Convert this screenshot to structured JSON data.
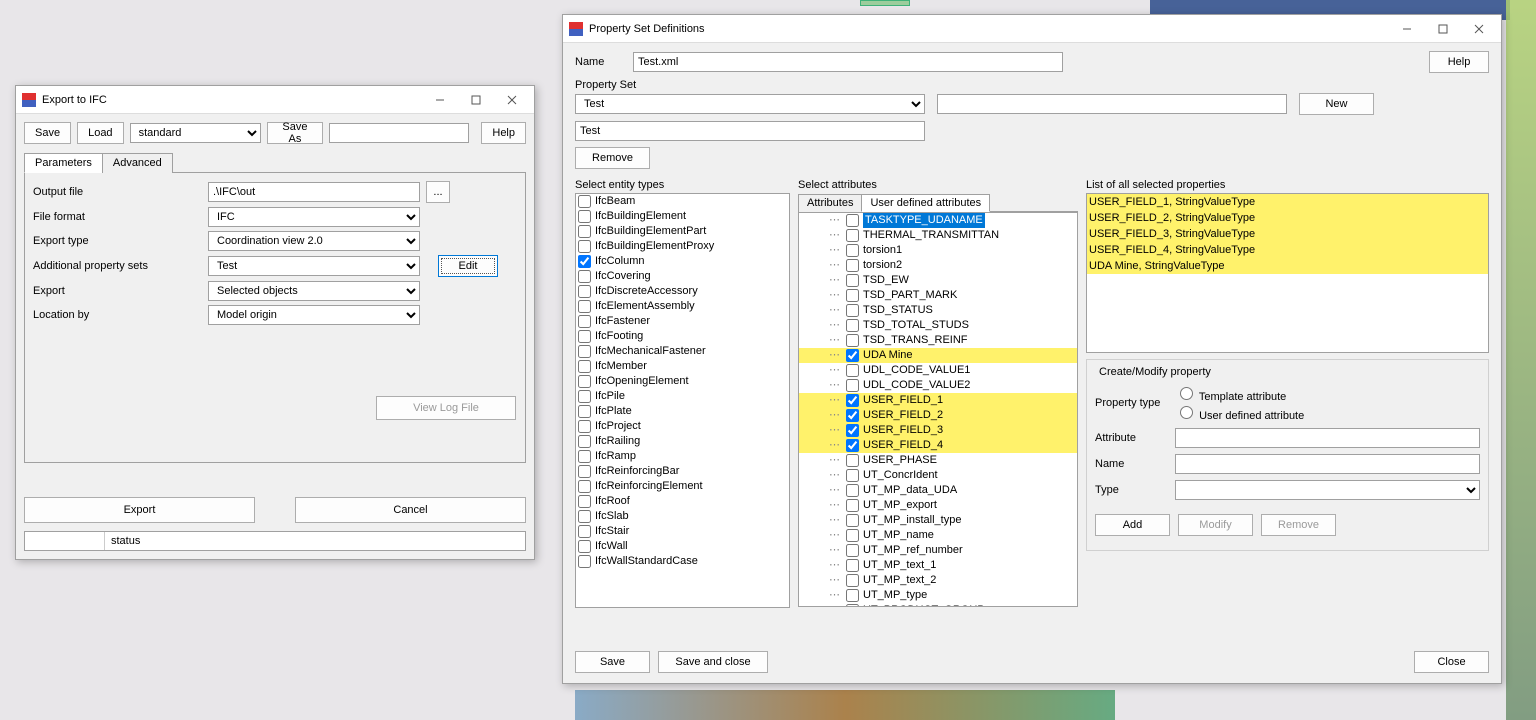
{
  "win1": {
    "title": "Export to IFC",
    "save": "Save",
    "load": "Load",
    "preset": "standard",
    "saveAs": "Save As",
    "help": "Help",
    "tab_params": "Parameters",
    "tab_adv": "Advanced",
    "rows": {
      "output_lbl": "Output file",
      "output_val": ".\\IFC\\out",
      "browse": "...",
      "format_lbl": "File format",
      "format_val": "IFC",
      "exptype_lbl": "Export type",
      "exptype_val": "Coordination view 2.0",
      "apsets_lbl": "Additional property sets",
      "apsets_val": "Test",
      "export_lbl": "Export",
      "export_val": "Selected objects",
      "loc_lbl": "Location by",
      "loc_val": "Model origin"
    },
    "edit": "Edit",
    "viewlog": "View Log File",
    "export": "Export",
    "cancel": "Cancel",
    "status": "status"
  },
  "win2": {
    "title": "Property Set Definitions",
    "name_lbl": "Name",
    "name_val": "Test.xml",
    "help": "Help",
    "pset_lbl": "Property Set",
    "pset_sel": "Test",
    "pset_name": "Test",
    "new": "New",
    "remove": "Remove",
    "entity_lbl": "Select entity types",
    "entities": [
      {
        "l": "IfcBeam",
        "c": false
      },
      {
        "l": "IfcBuildingElement",
        "c": false
      },
      {
        "l": "IfcBuildingElementPart",
        "c": false
      },
      {
        "l": "IfcBuildingElementProxy",
        "c": false
      },
      {
        "l": "IfcColumn",
        "c": true
      },
      {
        "l": "IfcCovering",
        "c": false
      },
      {
        "l": "IfcDiscreteAccessory",
        "c": false
      },
      {
        "l": "IfcElementAssembly",
        "c": false
      },
      {
        "l": "IfcFastener",
        "c": false
      },
      {
        "l": "IfcFooting",
        "c": false
      },
      {
        "l": "IfcMechanicalFastener",
        "c": false
      },
      {
        "l": "IfcMember",
        "c": false
      },
      {
        "l": "IfcOpeningElement",
        "c": false
      },
      {
        "l": "IfcPile",
        "c": false
      },
      {
        "l": "IfcPlate",
        "c": false
      },
      {
        "l": "IfcProject",
        "c": false
      },
      {
        "l": "IfcRailing",
        "c": false
      },
      {
        "l": "IfcRamp",
        "c": false
      },
      {
        "l": "IfcReinforcingBar",
        "c": false
      },
      {
        "l": "IfcReinforcingElement",
        "c": false
      },
      {
        "l": "IfcRoof",
        "c": false
      },
      {
        "l": "IfcSlab",
        "c": false
      },
      {
        "l": "IfcStair",
        "c": false
      },
      {
        "l": "IfcWall",
        "c": false
      },
      {
        "l": "IfcWallStandardCase",
        "c": false
      }
    ],
    "attr_lbl": "Select attributes",
    "atab1": "Attributes",
    "atab2": "User defined attributes",
    "attrs": [
      {
        "l": "TASKTYPE_UDANAME",
        "c": false,
        "sel": true
      },
      {
        "l": "THERMAL_TRANSMITTAN",
        "c": false
      },
      {
        "l": "torsion1",
        "c": false
      },
      {
        "l": "torsion2",
        "c": false
      },
      {
        "l": "TSD_EW",
        "c": false
      },
      {
        "l": "TSD_PART_MARK",
        "c": false
      },
      {
        "l": "TSD_STATUS",
        "c": false
      },
      {
        "l": "TSD_TOTAL_STUDS",
        "c": false
      },
      {
        "l": "TSD_TRANS_REINF",
        "c": false
      },
      {
        "l": "UDA Mine",
        "c": true,
        "hl": true
      },
      {
        "l": "UDL_CODE_VALUE1",
        "c": false
      },
      {
        "l": "UDL_CODE_VALUE2",
        "c": false
      },
      {
        "l": "USER_FIELD_1",
        "c": true,
        "hl": true
      },
      {
        "l": "USER_FIELD_2",
        "c": true,
        "hl": true
      },
      {
        "l": "USER_FIELD_3",
        "c": true,
        "hl": true
      },
      {
        "l": "USER_FIELD_4",
        "c": true,
        "hl": true
      },
      {
        "l": "USER_PHASE",
        "c": false
      },
      {
        "l": "UT_ConcrIdent",
        "c": false
      },
      {
        "l": "UT_MP_data_UDA",
        "c": false
      },
      {
        "l": "UT_MP_export",
        "c": false
      },
      {
        "l": "UT_MP_install_type",
        "c": false
      },
      {
        "l": "UT_MP_name",
        "c": false
      },
      {
        "l": "UT_MP_ref_number",
        "c": false
      },
      {
        "l": "UT_MP_text_1",
        "c": false
      },
      {
        "l": "UT_MP_text_2",
        "c": false
      },
      {
        "l": "UT_MP_type",
        "c": false
      },
      {
        "l": "UT_PRODUCT_GROUP",
        "c": false
      }
    ],
    "sel_lbl": "List of all selected properties",
    "selprops": [
      "USER_FIELD_1,  StringValueType",
      "USER_FIELD_2,  StringValueType",
      "USER_FIELD_3,  StringValueType",
      "USER_FIELD_4,  StringValueType",
      "UDA Mine,  StringValueType"
    ],
    "cm_lbl": "Create/Modify property",
    "ptype_lbl": "Property type",
    "ptype_a": "Template attribute",
    "ptype_b": "User defined attribute",
    "attrf": "Attribute",
    "namef": "Name",
    "typef": "Type",
    "add": "Add",
    "modify": "Modify",
    "remove2": "Remove",
    "save": "Save",
    "saveclose": "Save and close",
    "close": "Close"
  }
}
